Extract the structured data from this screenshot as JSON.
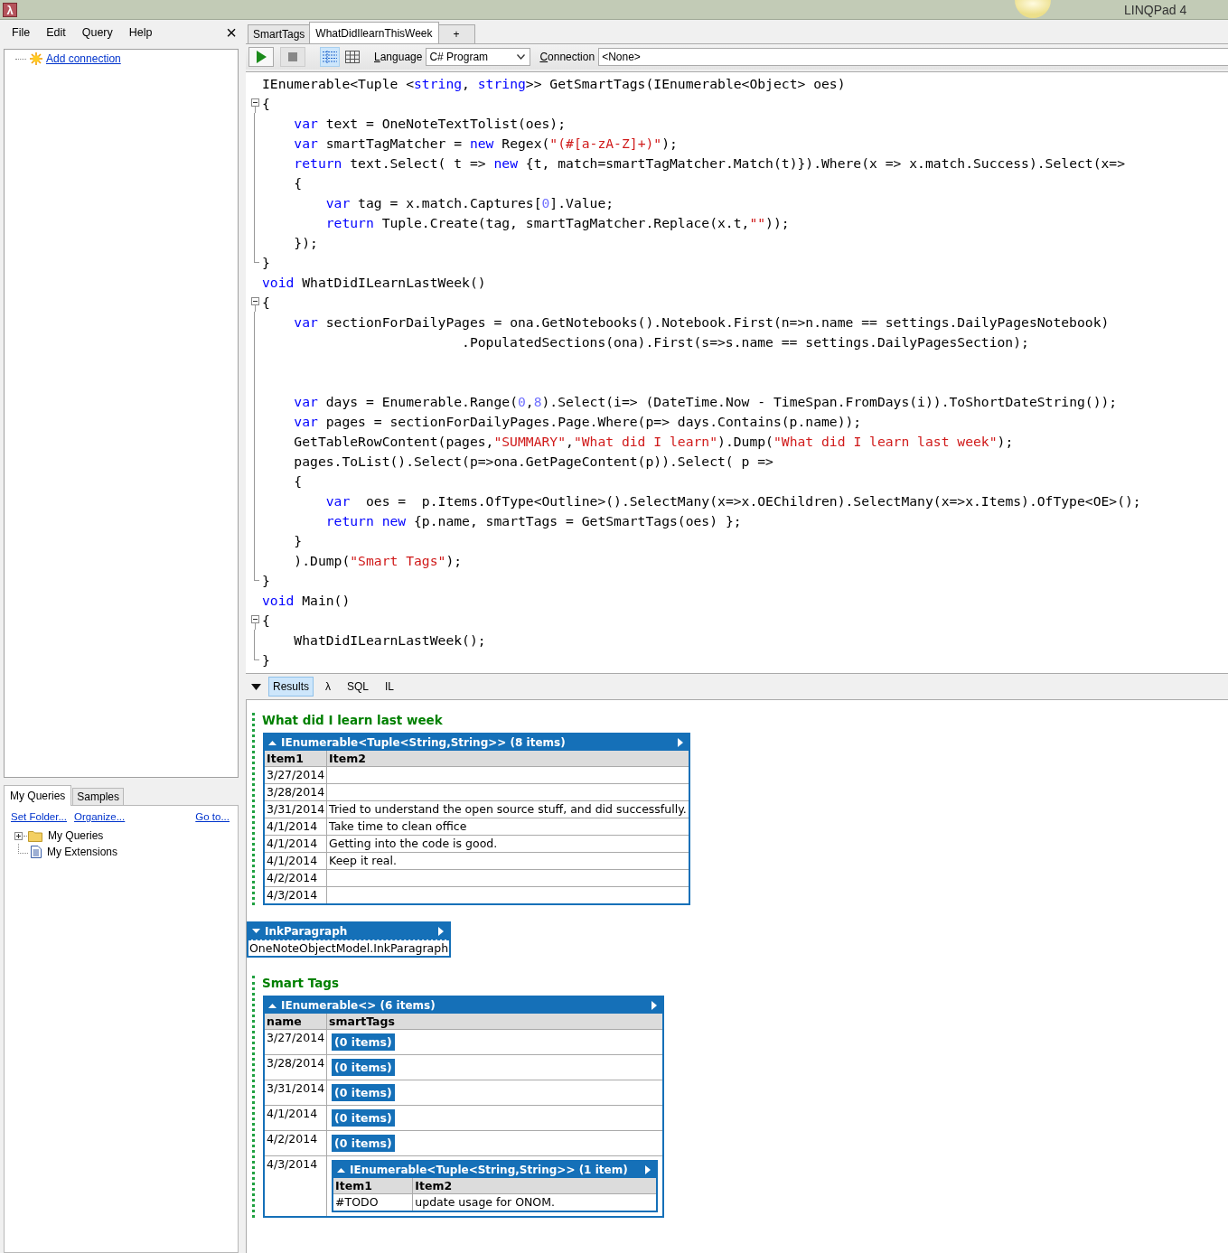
{
  "window": {
    "icon_glyph": "λ",
    "title": "LINQPad 4"
  },
  "menu": [
    "File",
    "Edit",
    "Query",
    "Help"
  ],
  "panel_close": "×",
  "connections": {
    "add_link": "Add connection"
  },
  "explorer_tabs": [
    {
      "label": "My Queries",
      "selected": true
    },
    {
      "label": "Samples",
      "selected": false
    }
  ],
  "explorer_links": [
    "Set Folder...",
    "Organize...",
    "Go to..."
  ],
  "explorer_tree": [
    {
      "label": "My Queries",
      "kind": "folder"
    },
    {
      "label": "My Extensions",
      "kind": "file"
    }
  ],
  "query_tabs": [
    {
      "label": "SmartTags",
      "selected": false
    },
    {
      "label": "WhatDidIlearnThisWeek",
      "selected": true
    }
  ],
  "new_tab": "+",
  "toolbar": {
    "views": [
      {
        "kind": "rich",
        "selected": true
      },
      {
        "kind": "grid",
        "selected": false
      }
    ],
    "language_label": "Language",
    "language": "C# Program",
    "connection_label": "Connection",
    "connection": "<None>"
  },
  "code": [
    {
      "kind": "line",
      "segments": [
        {
          "kind": "plain",
          "text": "IEnumerable<Tuple <"
        },
        {
          "kind": "keyword",
          "text": "string"
        },
        {
          "kind": "plain",
          "text": ", "
        },
        {
          "kind": "keyword",
          "text": "string"
        },
        {
          "kind": "plain",
          "text": ">> GetSmartTags(IEnumerable<Object> oes)"
        }
      ]
    },
    {
      "kind": "fold_start",
      "segments": [
        {
          "kind": "plain",
          "text": "{"
        }
      ]
    },
    {
      "kind": "line",
      "segments": [
        {
          "kind": "keyword",
          "text": "    var"
        },
        {
          "kind": "plain",
          "text": " text = OneNoteTextTolist(oes);"
        }
      ]
    },
    {
      "kind": "line",
      "segments": [
        {
          "kind": "keyword",
          "text": "    var"
        },
        {
          "kind": "plain",
          "text": " smartTagMatcher = "
        },
        {
          "kind": "keyword",
          "text": "new"
        },
        {
          "kind": "plain",
          "text": " Regex("
        },
        {
          "kind": "string",
          "text": "\"(#[a-zA-Z]+)\""
        },
        {
          "kind": "plain",
          "text": ");"
        }
      ]
    },
    {
      "kind": "line",
      "segments": [
        {
          "kind": "keyword",
          "text": "    return"
        },
        {
          "kind": "plain",
          "text": " text.Select( t => "
        },
        {
          "kind": "keyword",
          "text": "new"
        },
        {
          "kind": "plain",
          "text": " {t, match=smartTagMatcher.Match(t)}).Where(x => x.match.Success).Select(x=>"
        }
      ]
    },
    {
      "kind": "line",
      "segments": [
        {
          "kind": "plain",
          "text": "    {"
        }
      ]
    },
    {
      "kind": "line",
      "segments": [
        {
          "kind": "keyword",
          "text": "        var"
        },
        {
          "kind": "plain",
          "text": " tag = x.match.Captures["
        },
        {
          "kind": "number",
          "text": "0"
        },
        {
          "kind": "plain",
          "text": "].Value;"
        }
      ]
    },
    {
      "kind": "line",
      "segments": [
        {
          "kind": "keyword",
          "text": "        return"
        },
        {
          "kind": "plain",
          "text": " Tuple.Create(tag, smartTagMatcher.Replace(x.t,"
        },
        {
          "kind": "string",
          "text": "\"\""
        },
        {
          "kind": "plain",
          "text": "));"
        }
      ]
    },
    {
      "kind": "line",
      "segments": [
        {
          "kind": "plain",
          "text": "    });"
        }
      ]
    },
    {
      "kind": "fold_end",
      "segments": [
        {
          "kind": "plain",
          "text": "}"
        }
      ]
    },
    {
      "kind": "line",
      "segments": [
        {
          "kind": "keyword",
          "text": "void"
        },
        {
          "kind": "plain",
          "text": " WhatDidILearnLastWeek()"
        }
      ]
    },
    {
      "kind": "fold_start",
      "segments": [
        {
          "kind": "plain",
          "text": "{"
        }
      ]
    },
    {
      "kind": "line",
      "segments": [
        {
          "kind": "keyword",
          "text": "    var"
        },
        {
          "kind": "plain",
          "text": " sectionForDailyPages = ona.GetNotebooks().Notebook.First(n=>n.name == settings.DailyPagesNotebook)"
        }
      ]
    },
    {
      "kind": "line",
      "segments": [
        {
          "kind": "plain",
          "text": "                         .PopulatedSections(ona).First(s=>s.name == settings.DailyPagesSection);"
        }
      ]
    },
    {
      "kind": "blank"
    },
    {
      "kind": "blank"
    },
    {
      "kind": "line",
      "segments": [
        {
          "kind": "keyword",
          "text": "    var"
        },
        {
          "kind": "plain",
          "text": " days = Enumerable.Range("
        },
        {
          "kind": "number",
          "text": "0"
        },
        {
          "kind": "plain",
          "text": ","
        },
        {
          "kind": "number",
          "text": "8"
        },
        {
          "kind": "plain",
          "text": ").Select(i=> (DateTime.Now - TimeSpan.FromDays(i)).ToShortDateString());"
        }
      ]
    },
    {
      "kind": "line",
      "segments": [
        {
          "kind": "keyword",
          "text": "    var"
        },
        {
          "kind": "plain",
          "text": " pages = sectionForDailyPages.Page.Where(p=> days.Contains(p.name));"
        }
      ]
    },
    {
      "kind": "line",
      "segments": [
        {
          "kind": "plain",
          "text": "    GetTableRowContent(pages,"
        },
        {
          "kind": "string",
          "text": "\"SUMMARY\""
        },
        {
          "kind": "plain",
          "text": ","
        },
        {
          "kind": "string",
          "text": "\"What did I learn\""
        },
        {
          "kind": "plain",
          "text": ").Dump("
        },
        {
          "kind": "string",
          "text": "\"What did I learn last week\""
        },
        {
          "kind": "plain",
          "text": ");"
        }
      ]
    },
    {
      "kind": "line",
      "segments": [
        {
          "kind": "plain",
          "text": "    pages.ToList().Select(p=>ona.GetPageContent(p)).Select( p =>"
        }
      ]
    },
    {
      "kind": "line",
      "segments": [
        {
          "kind": "plain",
          "text": "    {"
        }
      ]
    },
    {
      "kind": "line",
      "segments": [
        {
          "kind": "keyword",
          "text": "        var"
        },
        {
          "kind": "plain",
          "text": "  oes =  p.Items.OfType<Outline>().SelectMany(x=>x.OEChildren).SelectMany(x=>x.Items).OfType<OE>();"
        }
      ]
    },
    {
      "kind": "line",
      "segments": [
        {
          "kind": "keyword",
          "text": "        return"
        },
        {
          "kind": "keyword",
          "text": " new"
        },
        {
          "kind": "plain",
          "text": " {p.name, smartTags = GetSmartTags(oes) };"
        }
      ]
    },
    {
      "kind": "line",
      "segments": [
        {
          "kind": "plain",
          "text": "    }"
        }
      ]
    },
    {
      "kind": "line",
      "segments": [
        {
          "kind": "plain",
          "text": "    ).Dump("
        },
        {
          "kind": "string",
          "text": "\"Smart Tags\""
        },
        {
          "kind": "plain",
          "text": ");"
        }
      ]
    },
    {
      "kind": "fold_end",
      "segments": [
        {
          "kind": "plain",
          "text": "}"
        }
      ]
    },
    {
      "kind": "line",
      "segments": [
        {
          "kind": "keyword",
          "text": "void"
        },
        {
          "kind": "plain",
          "text": " Main()"
        }
      ]
    },
    {
      "kind": "fold_start",
      "segments": [
        {
          "kind": "plain",
          "text": "{"
        }
      ]
    },
    {
      "kind": "line",
      "segments": [
        {
          "kind": "plain",
          "text": "    WhatDidILearnLastWeek();"
        }
      ]
    },
    {
      "kind": "fold_end",
      "segments": [
        {
          "kind": "plain",
          "text": "}"
        }
      ]
    }
  ],
  "results_tabs": [
    {
      "label": "Results",
      "selected": true
    },
    {
      "label": "λ",
      "selected": false
    },
    {
      "label": "SQL",
      "selected": false
    },
    {
      "label": "IL",
      "selected": false
    }
  ],
  "dumps": [
    {
      "heading": "What did I learn last week",
      "items": [
        {
          "kind": "table",
          "title": "IEnumerable<Tuple<String,String>> (8 items)",
          "expanded": true,
          "columns": [
            "Item1",
            "Item2"
          ],
          "rows": [
            [
              "3/27/2014",
              null
            ],
            [
              "3/28/2014",
              null
            ],
            [
              "3/31/2014",
              "Tried to understand the open source stuff, and did successfully."
            ],
            [
              "4/1/2014",
              "Take time to clean office"
            ],
            [
              "4/1/2014",
              "Getting into the code is good."
            ],
            [
              "4/1/2014",
              "Keep it real."
            ],
            [
              "4/2/2014",
              null
            ],
            [
              "4/3/2014",
              null
            ]
          ]
        }
      ]
    },
    {
      "items": [
        {
          "kind": "object",
          "title": "InkParagraph",
          "expanded": false,
          "value": "OneNoteObjectModel.InkParagraph"
        }
      ]
    },
    {
      "heading": "Smart Tags",
      "items": [
        {
          "kind": "table",
          "title": "IEnumerable<> (6 items)",
          "expanded": true,
          "columns": [
            "name",
            "smartTags"
          ],
          "rows": [
            [
              "3/27/2014",
              {
                "kind": "empty",
                "text": "(0 items)"
              }
            ],
            [
              "3/28/2014",
              {
                "kind": "empty",
                "text": "(0 items)"
              }
            ],
            [
              "3/31/2014",
              {
                "kind": "empty",
                "text": "(0 items)"
              }
            ],
            [
              "4/1/2014",
              {
                "kind": "empty",
                "text": "(0 items)"
              }
            ],
            [
              "4/2/2014",
              {
                "kind": "empty",
                "text": "(0 items)"
              }
            ],
            [
              "4/3/2014",
              {
                "kind": "table",
                "title": "IEnumerable<Tuple<String,String>> (1 item)",
                "expanded": true,
                "columns": [
                  "Item1",
                  "Item2"
                ],
                "rows": [
                  [
                    "#TODO",
                    "update usage for ONOM."
                  ]
                ]
              }
            ]
          ]
        }
      ]
    }
  ]
}
